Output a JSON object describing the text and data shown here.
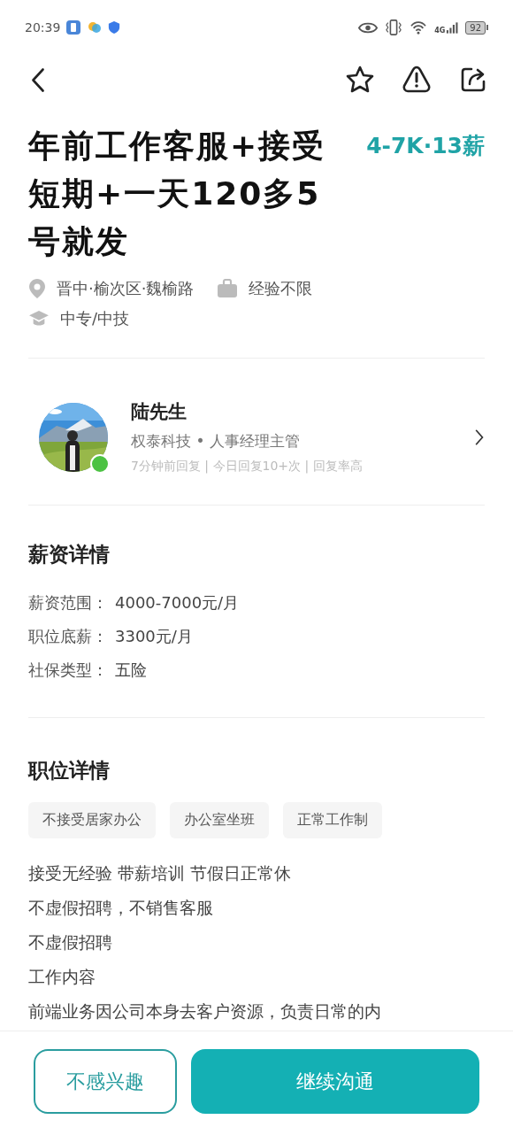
{
  "status_bar": {
    "time": "20:39",
    "network": "4G",
    "battery": "92"
  },
  "job": {
    "title": "年前工作客服+接受短期+一天120多5号就发",
    "salary": "4-7K·13薪",
    "location": "晋中·榆次区·魏榆路",
    "experience": "经验不限",
    "education": "中专/中技"
  },
  "recruiter": {
    "name": "陆先生",
    "company_role": "权泰科技 • 人事经理主管",
    "activity": "7分钟前回复 | 今日回复10+次 | 回复率高",
    "online": true
  },
  "salary_details": {
    "heading": "薪资详情",
    "rows": [
      {
        "label": "薪资范围：",
        "value": "4000-7000元/月"
      },
      {
        "label": "职位底薪：",
        "value": "3300元/月"
      },
      {
        "label": "社保类型：",
        "value": "五险"
      }
    ]
  },
  "job_details": {
    "heading": "职位详情",
    "tags": [
      "不接受居家办公",
      "办公室坐班",
      "正常工作制"
    ],
    "lines": [
      "接受无经验 带薪培训 节假日正常休",
      "不虚假招聘，不销售客服",
      "不虚假招聘",
      "工作内容",
      "前端业务因公司本身去客户资源，负责日常的内"
    ]
  },
  "buttons": [
    {
      "label": "不感兴趣",
      "kind": "secondary"
    },
    {
      "label": "继续沟通",
      "kind": "primary"
    }
  ]
}
